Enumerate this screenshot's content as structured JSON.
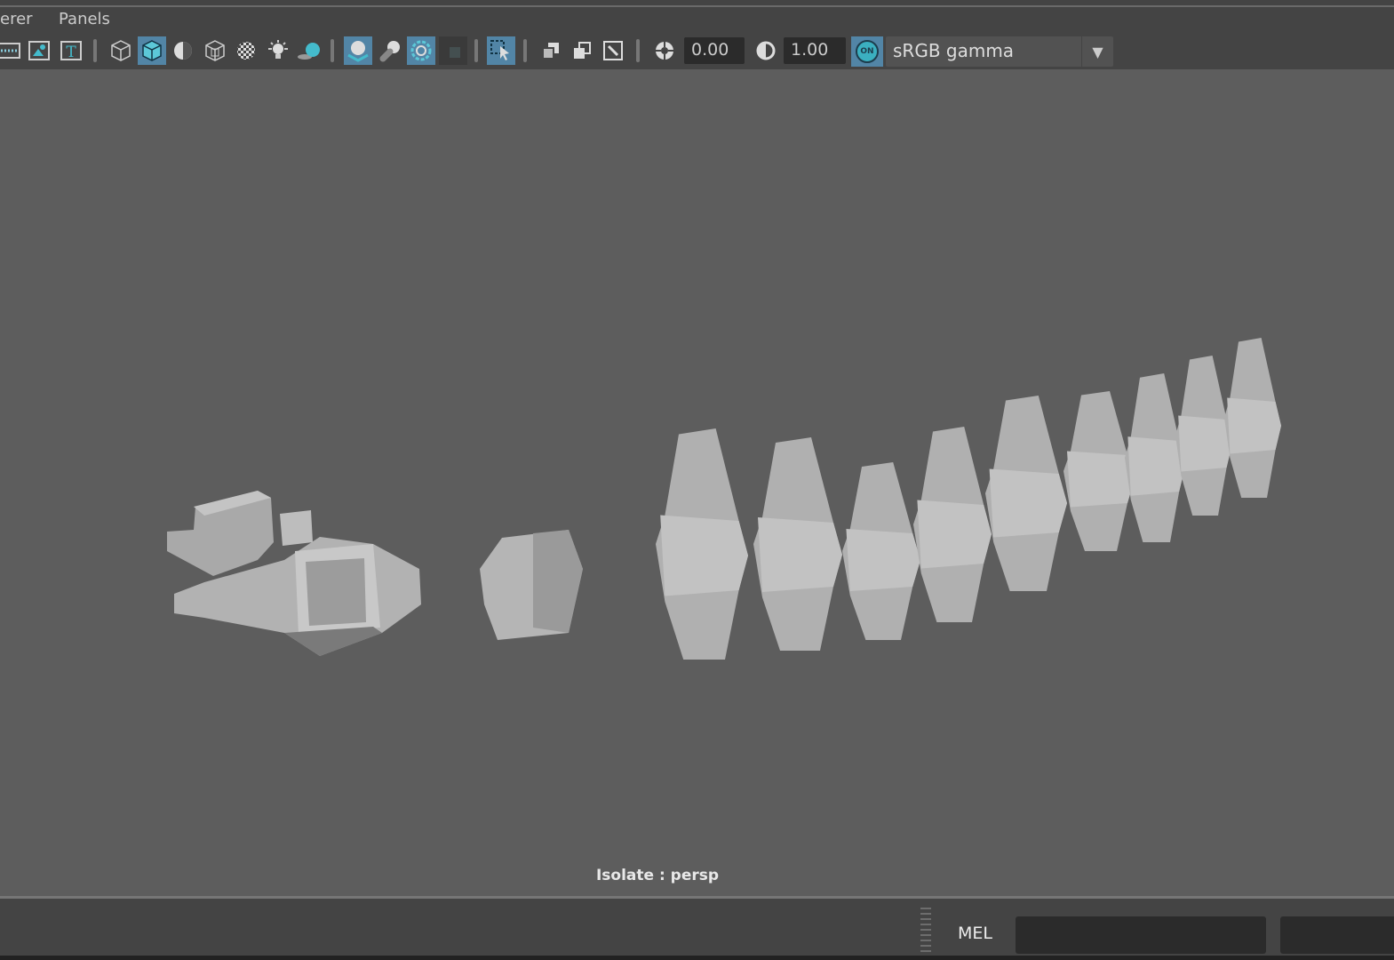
{
  "menubar": {
    "items": [
      "erer",
      "Panels"
    ]
  },
  "toolbar": {
    "icons": [
      "grid-icon",
      "film-gate-icon",
      "text-icon",
      "wireframe-cube-icon",
      "smooth-shade-icon",
      "default-material-icon",
      "bounding-box-icon",
      "textured-icon",
      "lights-icon",
      "shadows-icon",
      "screen-space-ao-icon",
      "motion-blur-icon",
      "anti-aliasing-icon",
      "depth-of-field-icon",
      "select-camera-icon",
      "isolate-select-icon",
      "xray-icon",
      "xray-joints-icon",
      "exposure-icon",
      "gamma-icon"
    ],
    "exposure_value": "0.00",
    "gamma_value": "1.00",
    "color_mgmt_toggle": "ON",
    "color_space": "sRGB gamma",
    "accent_color": "#5285a6"
  },
  "viewport": {
    "hud_label": "Isolate : persp",
    "background": "#5d5d5d"
  },
  "command_line": {
    "language": "MEL",
    "input_value": "",
    "result_value": ""
  }
}
